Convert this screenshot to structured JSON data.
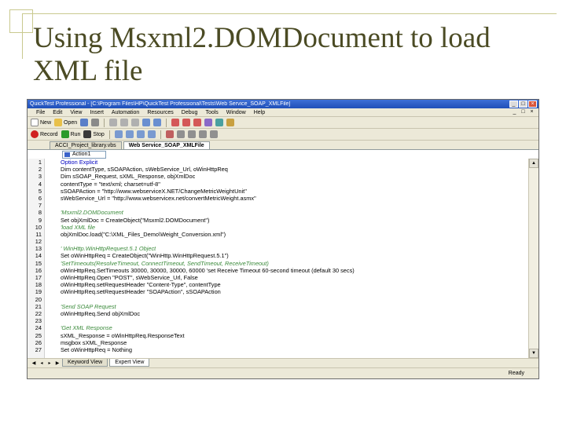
{
  "slide": {
    "title": "Using Msxml2.DOMDocument to load XML file"
  },
  "window": {
    "title": "QuickTest Professional - [C:\\Program Files\\HP\\QuickTest Professional\\Tests\\Web Service_SOAP_XMLFile]",
    "controls": [
      "_",
      "□",
      "×"
    ]
  },
  "menubar": {
    "items": [
      "File",
      "Edit",
      "View",
      "Insert",
      "Automation",
      "Resources",
      "Debug",
      "Tools",
      "Window",
      "Help"
    ],
    "mdi_controls": [
      "_",
      "□",
      "×"
    ]
  },
  "toolbar1": {
    "new_label": "New",
    "open_label": "Open"
  },
  "toolbar2": {
    "record_label": "Record",
    "run_label": "Run",
    "stop_label": "Stop"
  },
  "tabs": [
    {
      "label": "ACCI_Project_library.vbs",
      "active": false
    },
    {
      "label": "Web Service_SOAP_XMLFile",
      "active": true
    }
  ],
  "action_selector": {
    "value": "Action1"
  },
  "code_lines": [
    {
      "n": "1",
      "text": "Option Explicit",
      "style": "keyword"
    },
    {
      "n": "2",
      "text": "Dim contentType, sSOAPAction, sWebService_Url, oWinHttpReq",
      "style": "plain"
    },
    {
      "n": "3",
      "text": "Dim sSOAP_Request, sXML_Response, objXmlDoc",
      "style": "plain"
    },
    {
      "n": "4",
      "text": "contentType = \"text/xml; charset=utf-8\"",
      "style": "plain"
    },
    {
      "n": "5",
      "text": "sSOAPAction = \"http://www.webserviceX.NET/ChangeMetricWeightUnit\"",
      "style": "plain"
    },
    {
      "n": "6",
      "text": "sWebService_Url = \"http://www.webservicex.net/convertMetricWeight.asmx\"",
      "style": "plain"
    },
    {
      "n": "7",
      "text": "",
      "style": "plain"
    },
    {
      "n": "8",
      "text": "'Msxml2.DOMDocument",
      "style": "comment"
    },
    {
      "n": "9",
      "text": "Set objXmlDoc = CreateObject(\"Msxml2.DOMDocument\")",
      "style": "plain"
    },
    {
      "n": "10",
      "text": "'load XML file",
      "style": "comment"
    },
    {
      "n": "11",
      "text": "objXmlDoc.load(\"C:\\XML_Files_Demo\\Weight_Conversion.xml\")",
      "style": "plain"
    },
    {
      "n": "12",
      "text": "",
      "style": "plain"
    },
    {
      "n": "13",
      "text": "' WinHttp.WinHttpRequest.5.1 Object",
      "style": "comment"
    },
    {
      "n": "14",
      "text": "Set oWinHttpReq = CreateObject(\"WinHttp.WinHttpRequest.5.1\")",
      "style": "plain"
    },
    {
      "n": "15",
      "text": "'SetTimeouts(ResolveTimeout, ConnectTimeout, SendTimeout, ReceiveTimeout)",
      "style": "comment"
    },
    {
      "n": "16",
      "text": "oWinHttpReq.SetTimeouts 30000, 30000, 30000, 60000 'set Receive Timeout 60-second timeout (default 30 secs)",
      "style": "plain"
    },
    {
      "n": "17",
      "text": "oWinHttpReq.Open \"POST\", sWebService_Url, False",
      "style": "plain"
    },
    {
      "n": "18",
      "text": "oWinHttpReq.setRequestHeader \"Content-Type\", contentType",
      "style": "plain"
    },
    {
      "n": "19",
      "text": "oWinHttpReq.setRequestHeader \"SOAPAction\", sSOAPAction",
      "style": "plain"
    },
    {
      "n": "20",
      "text": "",
      "style": "plain"
    },
    {
      "n": "21",
      "text": "'Send SOAP Request",
      "style": "comment"
    },
    {
      "n": "22",
      "text": "oWinHttpReq.Send objXmlDoc",
      "style": "plain"
    },
    {
      "n": "23",
      "text": "",
      "style": "plain"
    },
    {
      "n": "24",
      "text": "'Get XML Response",
      "style": "comment"
    },
    {
      "n": "25",
      "text": "sXML_Response = oWinHttpReq.ResponseText",
      "style": "plain"
    },
    {
      "n": "26",
      "text": "msgbox sXML_Response",
      "style": "plain"
    },
    {
      "n": "27",
      "text": "Set oWinHttpReq = Nothing",
      "style": "plain"
    }
  ],
  "view_tabs": [
    {
      "label": "Keyword View",
      "active": false
    },
    {
      "label": "Expert View",
      "active": true
    }
  ],
  "status": {
    "text": "Ready"
  },
  "colors": {
    "title_text": "#4b4b24",
    "slide_accent": "#c9c98f",
    "titlebar": "#2a5cc6",
    "comment": "#3a8a3a"
  }
}
